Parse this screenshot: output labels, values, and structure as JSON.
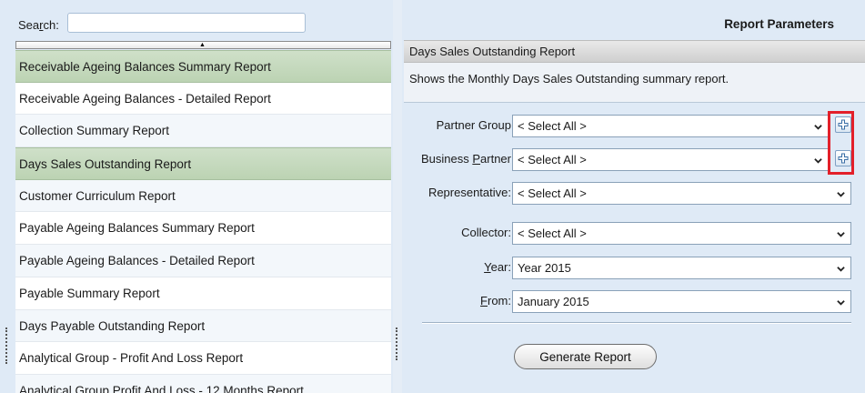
{
  "search": {
    "label_pre": "Sea",
    "label_ul": "r",
    "label_post": "ch:",
    "value": "",
    "placeholder": ""
  },
  "report_list": {
    "items": [
      "Receivable Ageing Balances Summary Report",
      "Receivable Ageing Balances - Detailed Report",
      "Collection Summary Report",
      "Days Sales Outstanding Report",
      "Customer Curriculum Report",
      "Payable Ageing Balances Summary Report",
      "Payable Ageing Balances - Detailed Report",
      "Payable Summary Report",
      "Days Payable Outstanding Report",
      "Analytical Group - Profit And Loss Report",
      "Analytical Group Profit And Loss - 12 Months Report"
    ],
    "selected_index": 3
  },
  "report_parameters": {
    "title": "Report Parameters",
    "report_name": "Days Sales Outstanding Report",
    "description": "Shows the Monthly Days Sales Outstanding summary report.",
    "params": {
      "partner_group": {
        "label": "Partner Group",
        "value": "< Select All >"
      },
      "business_partner": {
        "label_pre": "Business ",
        "label_ul": "P",
        "label_post": "artner",
        "value": "< Select All >"
      },
      "representative": {
        "label": "Representative:",
        "value": "< Select All >"
      },
      "collector": {
        "label": "Collector:",
        "value": "< Select All >"
      },
      "year": {
        "label_ul": "Y",
        "label_post": "ear:",
        "value": "Year 2015"
      },
      "from": {
        "label_ul": "F",
        "label_post": "rom:",
        "value": "January 2015"
      }
    },
    "generate_button": "Generate Report"
  },
  "icons": {
    "add": "plus-icon",
    "dropdown": "chevron-down-icon",
    "sort": "sort-up-icon"
  },
  "colors": {
    "selected_row": "#c6d9bf",
    "highlight_box": "#e3202a",
    "background": "#dfeaf6"
  }
}
